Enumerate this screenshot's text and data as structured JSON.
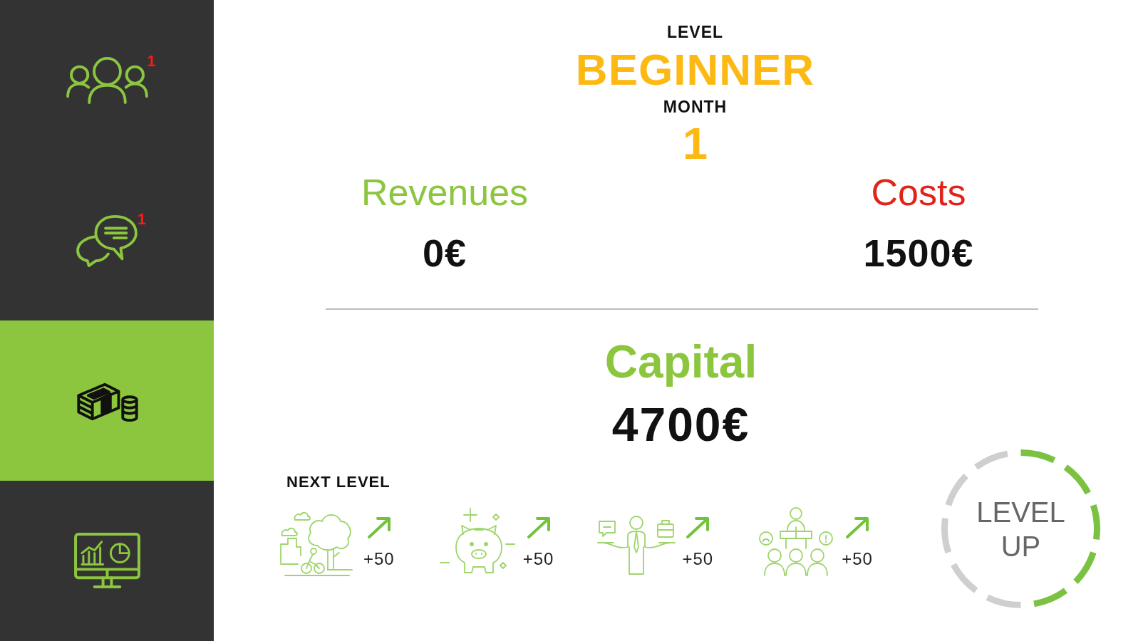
{
  "sidebar": {
    "items": [
      {
        "kind": "team",
        "badge": "1",
        "selected": false
      },
      {
        "kind": "chat",
        "badge": "1",
        "selected": false
      },
      {
        "kind": "money",
        "selected": true
      },
      {
        "kind": "dashboard",
        "selected": false
      }
    ]
  },
  "header": {
    "level_label": "LEVEL",
    "level": "BEGINNER",
    "month_label": "MONTH",
    "month": "1"
  },
  "summary": [
    {
      "label": "Revenues",
      "color": "#8cc63f",
      "value": "0€"
    },
    {
      "label": "Costs",
      "color": "#e2231a",
      "value": "1500€"
    }
  ],
  "capital": {
    "label": "Capital",
    "value": "4700€"
  },
  "next_level": {
    "title": "NEXT LEVEL",
    "items": [
      {
        "kind": "park",
        "bonus": "+50"
      },
      {
        "kind": "savings",
        "bonus": "+50"
      },
      {
        "kind": "career",
        "bonus": "+50"
      },
      {
        "kind": "training",
        "bonus": "+50"
      }
    ]
  },
  "level_up": {
    "label": "LEVEL UP",
    "level": 0.5
  }
}
